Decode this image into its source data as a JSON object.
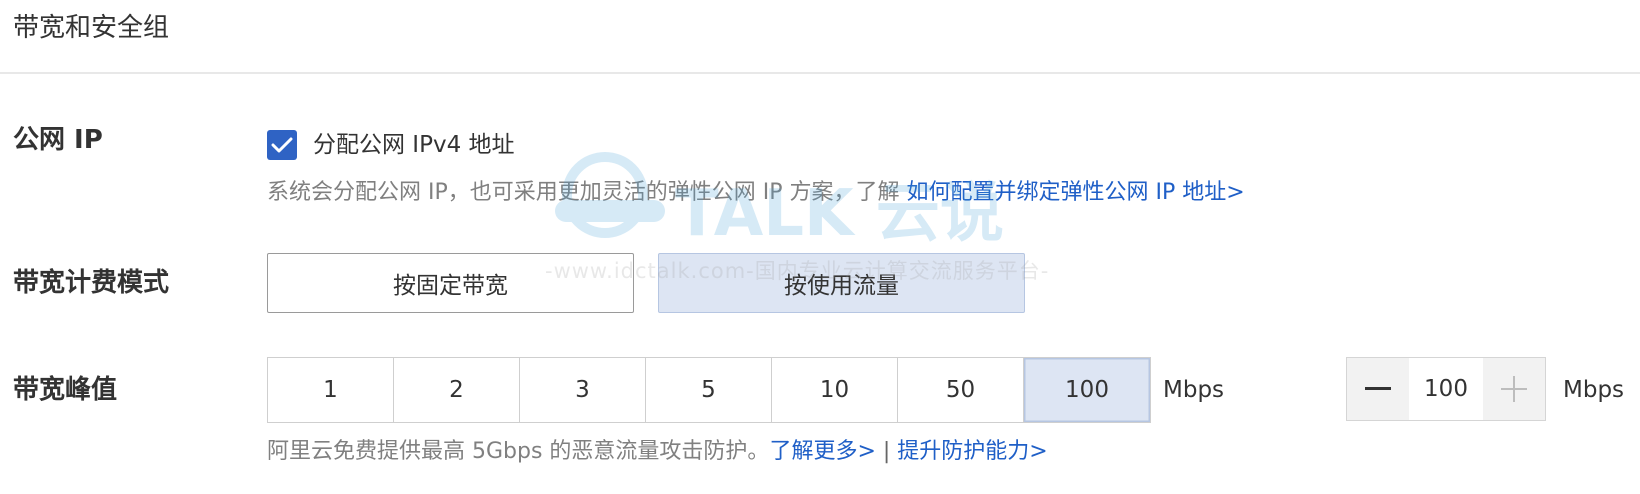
{
  "section": {
    "title": "带宽和安全组"
  },
  "public_ip": {
    "label": "公网 IP",
    "checkbox_label": "分配公网 IPv4 地址",
    "checked": true,
    "help_text": "系统会分配公网 IP，也可采用更加灵活的弹性公网 IP 方案，了解 ",
    "help_link": "如何配置并绑定弹性公网 IP 地址>"
  },
  "billing_mode": {
    "label": "带宽计费模式",
    "options": [
      "按固定带宽",
      "按使用流量"
    ],
    "selected": "按使用流量"
  },
  "bandwidth_peak": {
    "label": "带宽峰值",
    "options": [
      "1",
      "2",
      "3",
      "5",
      "10",
      "50",
      "100"
    ],
    "selected": "100",
    "unit": "Mbps",
    "stepper_value": "100",
    "stepper_unit": "Mbps",
    "help_text": "阿里云免费提供最高 5Gbps 的恶意流量攻击防护。",
    "link_more": "了解更多>",
    "separator": " | ",
    "link_upgrade": "提升防护能力>"
  },
  "watermark": {
    "brand": "TALK 云说",
    "text": "-www.idctalk.com-国内专业云计算交流服务平台-"
  },
  "colors": {
    "accent": "#2f63c4",
    "link": "#1f5fc7",
    "selected_bg": "#dde5f3"
  }
}
